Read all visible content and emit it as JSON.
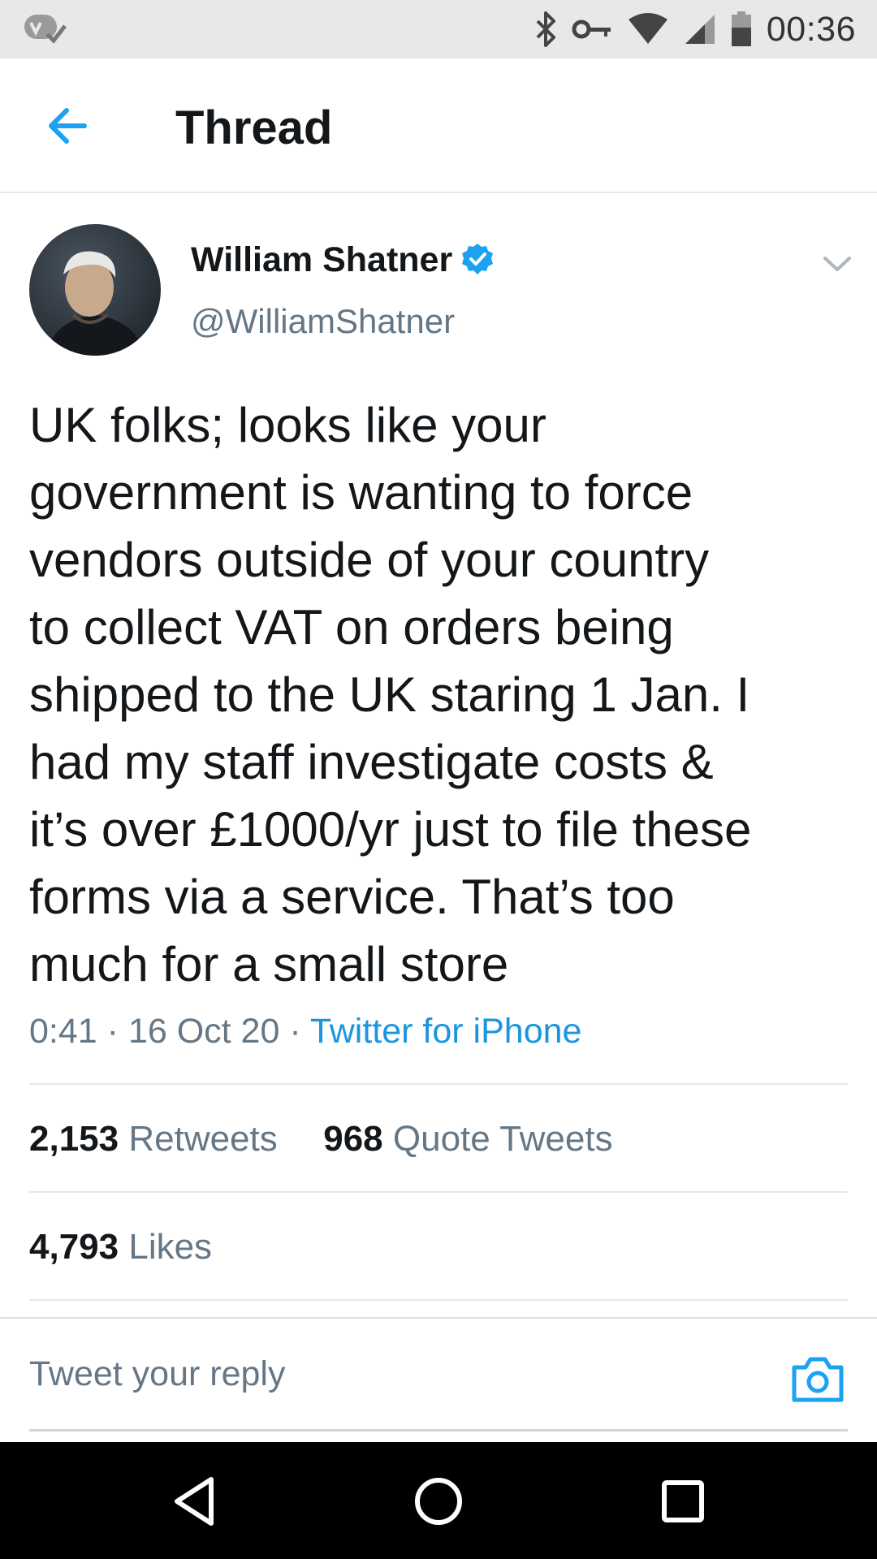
{
  "status_bar": {
    "time": "00:36",
    "icons": [
      "app-notification-icon",
      "bluetooth-icon",
      "vpn-key-icon",
      "wifi-icon",
      "signal-icon",
      "battery-icon"
    ]
  },
  "header": {
    "back_icon": "arrow-left-icon",
    "title": "Thread"
  },
  "tweet": {
    "author_name": "William Shatner",
    "author_handle": "@WilliamShatner",
    "verified": true,
    "text": "UK folks; looks like your\ngovernment is wanting to force\nvendors outside of your country\nto collect VAT on orders being\nshipped to the UK staring 1 Jan. I\nhad my staff investigate costs &\nit’s over £1000/yr just to file these\nforms via a service. That’s too\nmuch for a small store",
    "time": "0:41",
    "date": "16 Oct 20",
    "separator": "·",
    "source": "Twitter for iPhone"
  },
  "stats": {
    "retweets_count": "2,153",
    "retweets_label": "Retweets",
    "quote_tweets_count": "968",
    "quote_tweets_label": "Quote Tweets",
    "likes_count": "4,793",
    "likes_label": "Likes"
  },
  "reply": {
    "placeholder": "Tweet your reply",
    "camera_icon": "camera-icon"
  },
  "nav_bar": {
    "icons": [
      "back-triangle-icon",
      "home-circle-icon",
      "recents-square-icon"
    ]
  },
  "colors": {
    "accent": "#1DA1F2",
    "link": "#1B95E0",
    "secondary_text": "#657786",
    "primary_text": "#14171A",
    "divider": "#E1E8ED",
    "status_bar_bg": "#E8E8E8",
    "nav_bar_bg": "#000000"
  }
}
